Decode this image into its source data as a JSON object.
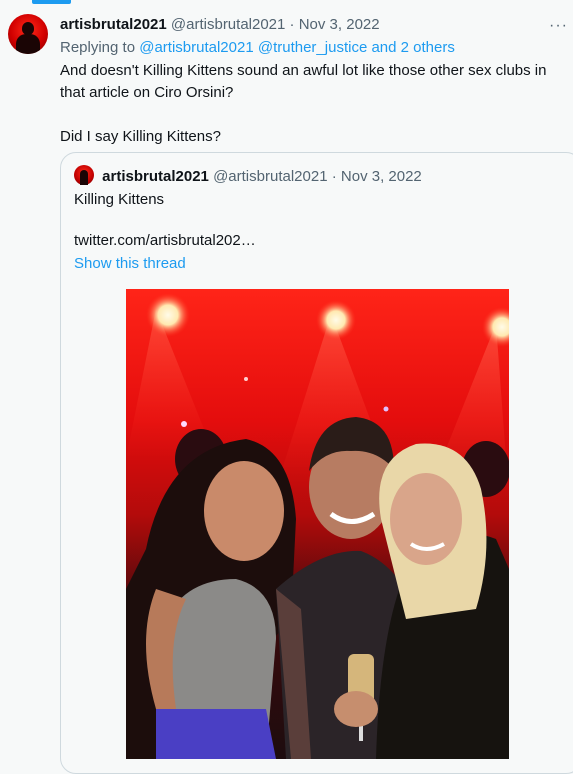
{
  "tweet": {
    "display_name": "artisbrutal2021",
    "handle": "@artisbrutal2021",
    "separator": "·",
    "date": "Nov 3, 2022",
    "more_icon": "more-dots-icon",
    "reply_prefix": "Replying to",
    "reply_mentions": "@artisbrutal2021 @truther_justice and 2 others",
    "body_line1": "And doesn't Killing Kittens sound an awful lot like those other sex clubs in that article on Ciro Orsini?",
    "body_line2": "Did I say Killing Kittens?"
  },
  "quoted": {
    "display_name": "artisbrutal2021",
    "handle": "@artisbrutal2021",
    "separator": "·",
    "date": "Nov 3, 2022",
    "text": "Killing Kittens",
    "url": "twitter.com/artisbrutal202…",
    "show_thread": "Show this thread",
    "photo_desc_icon": "photo-of-three-people-at-party"
  },
  "colors": {
    "accent": "#1d9bf0",
    "muted": "#536471",
    "background": "#f7f9f9"
  }
}
